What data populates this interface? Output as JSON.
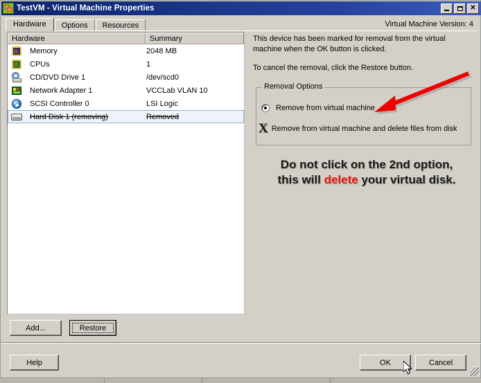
{
  "window": {
    "title": "TestVM - Virtual Machine Properties",
    "icon": "vm-icon",
    "minimize_label": "_",
    "maximize_label": "□",
    "close_label": "✕"
  },
  "tabs": [
    {
      "label": "Hardware",
      "active": true
    },
    {
      "label": "Options",
      "active": false
    },
    {
      "label": "Resources",
      "active": false
    }
  ],
  "version_label": "Virtual Machine Version: 4",
  "hardware_list": {
    "columns": [
      "Hardware",
      "Summary"
    ],
    "rows": [
      {
        "icon": "memory-icon",
        "name": "Memory",
        "summary": "2048 MB",
        "selected": false,
        "removed": false
      },
      {
        "icon": "cpu-icon",
        "name": "CPUs",
        "summary": "1",
        "selected": false,
        "removed": false
      },
      {
        "icon": "cd-dvd-icon",
        "name": "CD/DVD Drive 1",
        "summary": "/dev/scd0",
        "selected": false,
        "removed": false
      },
      {
        "icon": "network-adapter-icon",
        "name": "Network Adapter 1",
        "summary": "VCCLab VLAN 10",
        "selected": false,
        "removed": false
      },
      {
        "icon": "scsi-controller-icon",
        "name": "SCSI Controller 0",
        "summary": "LSI Logic",
        "selected": false,
        "removed": false
      },
      {
        "icon": "hard-disk-icon",
        "name": "Hard Disk 1 (removing)",
        "summary": "Removed",
        "selected": true,
        "removed": true
      }
    ]
  },
  "details": {
    "paragraph1": "This device has been marked for removal from the virtual machine when the OK button is clicked.",
    "paragraph2": "To cancel the removal, click the Restore button.",
    "group_title": "Removal Options",
    "options": [
      {
        "label": "Remove from virtual machine",
        "selected": true
      },
      {
        "label": "Remove from virtual machine and delete files from disk",
        "selected": false
      }
    ]
  },
  "annotation": {
    "line1": "Do not click on the 2nd option,",
    "line2_before": "this will ",
    "line2_red": "delete",
    "line2_after": " your virtual disk.",
    "arrow_color": "#ee0000",
    "red_color": "#ee1111",
    "x_mark": "X"
  },
  "buttons": {
    "add": "Add...",
    "restore": "Restore",
    "help": "Help",
    "ok": "OK",
    "cancel": "Cancel"
  }
}
